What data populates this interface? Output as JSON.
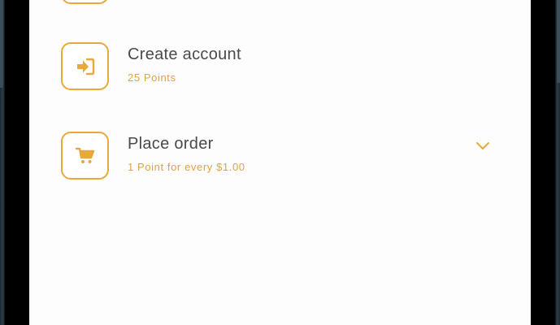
{
  "colors": {
    "accent": "#e8a93a",
    "subtitle": "#e3a13a",
    "title": "#4a4a4a",
    "screen_bg": "#fdfdfd"
  },
  "rewards": [
    {
      "title": "Create account",
      "subtitle": "25 Points",
      "icon": "sign-in-icon"
    },
    {
      "title": "Place order",
      "subtitle": "1 Point for every $1.00",
      "icon": "cart-icon",
      "expandable": true
    }
  ]
}
